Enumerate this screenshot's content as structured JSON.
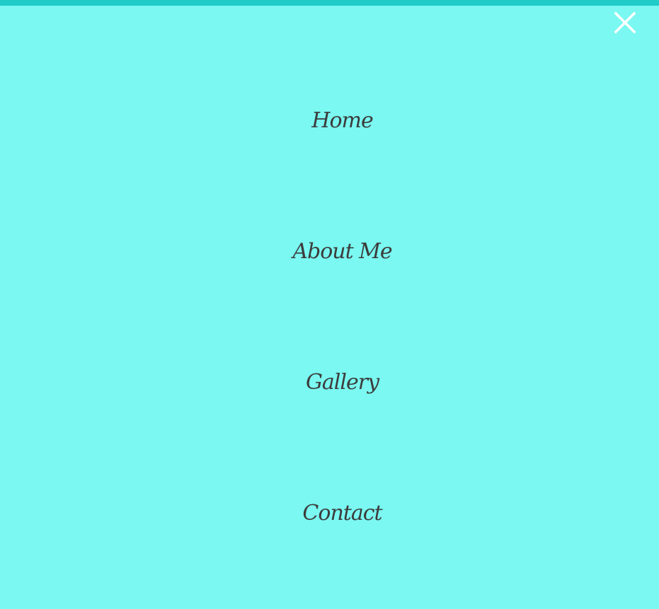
{
  "menu": {
    "items": [
      {
        "label": "Home"
      },
      {
        "label": "About Me"
      },
      {
        "label": "Gallery"
      },
      {
        "label": "Contact"
      }
    ],
    "close_icon": "close-icon"
  },
  "colors": {
    "background": "#7af8f1",
    "top_bar": "#20cbc8",
    "text": "#3c3c3c",
    "close_icon": "#ffffff"
  }
}
